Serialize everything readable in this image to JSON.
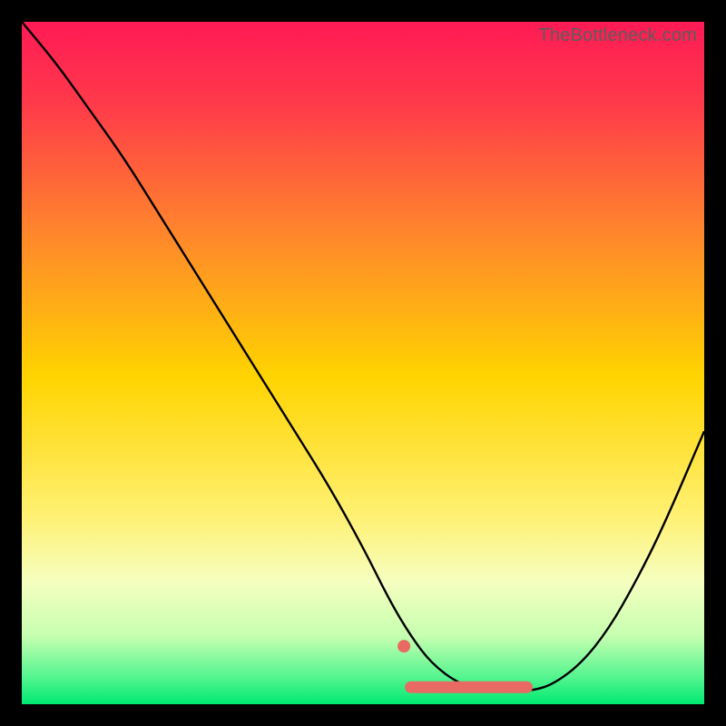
{
  "watermark": "TheBottleneck.com",
  "colors": {
    "frame": "#000000",
    "top": "#ff1a55",
    "mid": "#ffd400",
    "pale": "#f6ffbf",
    "green": "#00e972",
    "curve": "#000000",
    "marker": "#e86a63"
  },
  "chart_data": {
    "type": "line",
    "title": "",
    "xlabel": "",
    "ylabel": "",
    "xlim": [
      0,
      100
    ],
    "ylim": [
      0,
      100
    ],
    "series": [
      {
        "name": "bottleneck-curve",
        "x": [
          0,
          5,
          10,
          15,
          20,
          25,
          30,
          35,
          40,
          45,
          50,
          54,
          57,
          60,
          64,
          68,
          72,
          75,
          78,
          82,
          86,
          90,
          94,
          100
        ],
        "values": [
          100,
          94,
          87,
          80,
          72,
          64,
          56,
          48,
          40,
          32,
          23,
          15,
          10,
          6,
          3,
          2,
          2,
          2,
          3,
          6,
          11,
          18,
          26,
          40
        ]
      }
    ],
    "markers": {
      "name": "optimal-range",
      "color": "#e86a63",
      "dot": {
        "x": 56,
        "y": 8.5
      },
      "band": {
        "x_start": 57,
        "x_end": 74,
        "y": 2.5
      }
    },
    "gradient_stops": [
      {
        "pct": 0,
        "color": "#ff1a55"
      },
      {
        "pct": 12,
        "color": "#ff3a4a"
      },
      {
        "pct": 32,
        "color": "#ff8a2a"
      },
      {
        "pct": 52,
        "color": "#ffd400"
      },
      {
        "pct": 72,
        "color": "#fff070"
      },
      {
        "pct": 82,
        "color": "#f6ffbf"
      },
      {
        "pct": 90,
        "color": "#c6ffb0"
      },
      {
        "pct": 96,
        "color": "#55f590"
      },
      {
        "pct": 100,
        "color": "#00e972"
      }
    ]
  }
}
